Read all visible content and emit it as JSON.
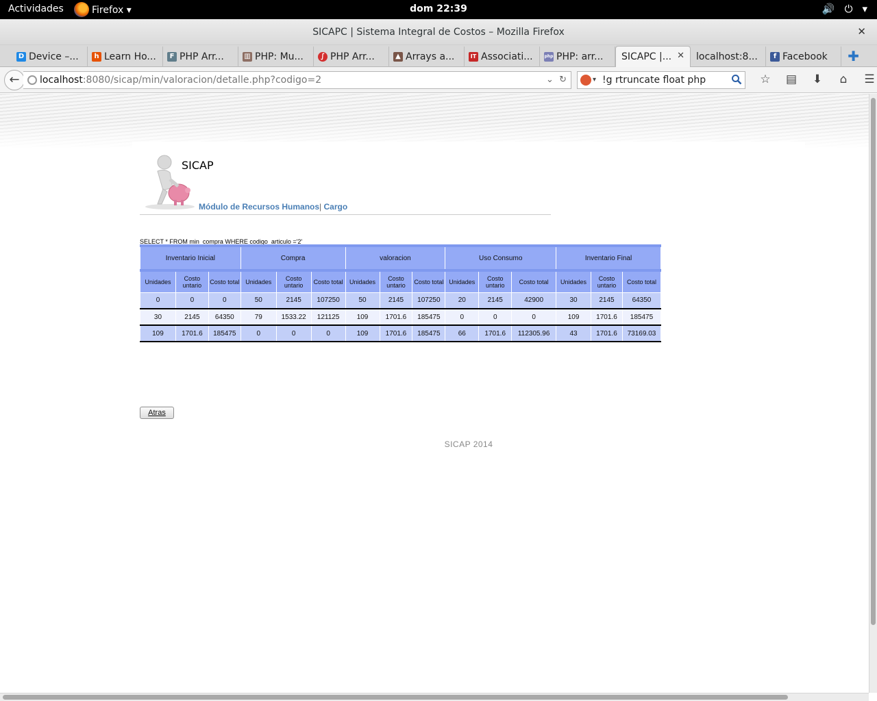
{
  "system": {
    "activities": "Actividades",
    "app_name": "Firefox ▾",
    "clock": "dom 22:39"
  },
  "window": {
    "title": "SICAPC | Sistema Integral de Costos – Mozilla Firefox"
  },
  "tabs": [
    {
      "label": "Device –...",
      "icon_color": "#1e88e5",
      "icon_glyph": "D"
    },
    {
      "label": "Learn Ho...",
      "icon_color": "#e65100",
      "icon_glyph": "h"
    },
    {
      "label": "PHP Arr...",
      "icon_color": "#607d8b",
      "icon_glyph": "F"
    },
    {
      "label": "PHP: Mu...",
      "icon_color": "#8d6e63",
      "icon_glyph": "▥"
    },
    {
      "label": "PHP Arr...",
      "icon_color": "#d32f2f",
      "icon_glyph": "∫"
    },
    {
      "label": "Arrays a...",
      "icon_color": "#795548",
      "icon_glyph": "▲"
    },
    {
      "label": "Associati...",
      "icon_color": "#c62828",
      "icon_glyph": "IT"
    },
    {
      "label": "PHP: arr...",
      "icon_color": "#7b7fb5",
      "icon_glyph": "php"
    },
    {
      "label": "SICAPC |...",
      "icon_color": "",
      "icon_glyph": "",
      "active": true
    },
    {
      "label": "localhost:8...",
      "icon_color": "",
      "icon_glyph": ""
    },
    {
      "label": "Facebook",
      "icon_color": "#3b5998",
      "icon_glyph": "f"
    }
  ],
  "nav": {
    "url_host": "localhost",
    "url_path": ":8080/sicap/min/valoracion/detalle.php?codigo=2",
    "search_value": "!g rtruncate float php"
  },
  "page": {
    "logo_text": "SICAP",
    "module_link": "Módulo de Recursos Humanos",
    "separator": "|",
    "cargo_link": "Cargo",
    "sql": "SELECT * FROM min_compra WHERE codigo_articulo ='2'",
    "table": {
      "groups": [
        "Inventario Inicial",
        "Compra",
        "valoracion",
        "Uso Consumo",
        "Inventario Final"
      ],
      "subheaders": [
        "Unidades",
        "Costo untario",
        "Costo total"
      ],
      "last_subheader": "Costo total",
      "rows": [
        [
          "0",
          "0",
          "0",
          "50",
          "2145",
          "107250",
          "50",
          "2145",
          "107250",
          "20",
          "2145",
          "42900",
          "30",
          "2145",
          "64350"
        ],
        [
          "30",
          "2145",
          "64350",
          "79",
          "1533.22",
          "121125",
          "109",
          "1701.6",
          "185475",
          "0",
          "0",
          "0",
          "109",
          "1701.6",
          "185475"
        ],
        [
          "109",
          "1701.6",
          "185475",
          "0",
          "0",
          "0",
          "109",
          "1701.6",
          "185475",
          "66",
          "1701.6",
          "112305.96",
          "43",
          "1701.6",
          "73169.03"
        ]
      ]
    },
    "back_button": "Atras",
    "footer": "SICAP 2014"
  }
}
